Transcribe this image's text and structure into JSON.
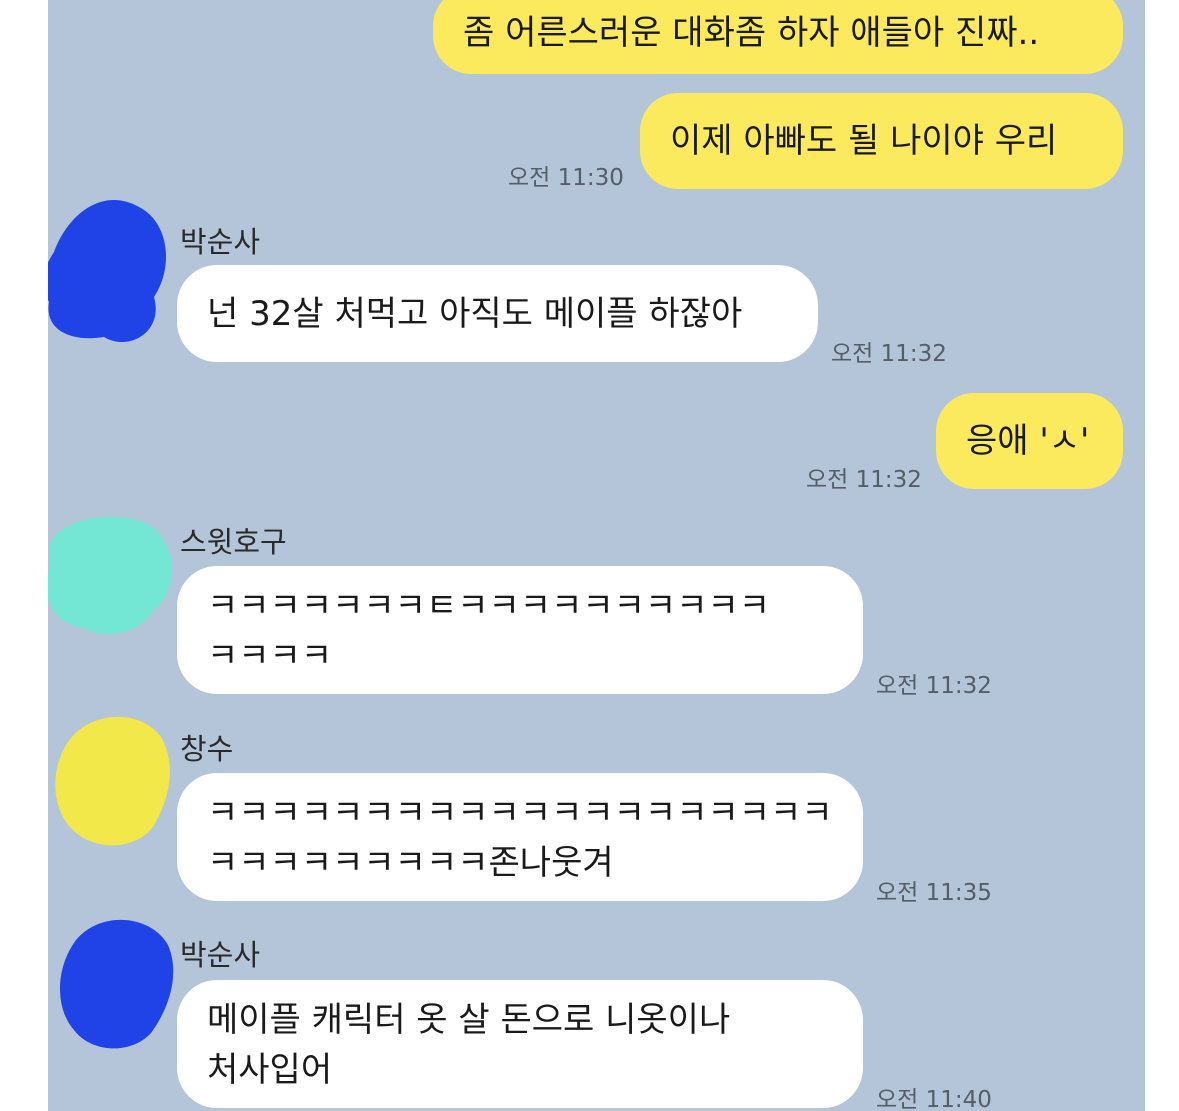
{
  "messages": [
    {
      "side": "mine",
      "text": "좀 어른스러운 대화좀 하자 애들아 진짜.."
    },
    {
      "side": "mine",
      "text": "이제 아빠도 될 나이야 우리",
      "time": "오전 11:30"
    },
    {
      "side": "theirs",
      "sender": "박순사",
      "text": "넌 32살 처먹고 아직도 메이플 하잖아",
      "time": "오전 11:32"
    },
    {
      "side": "mine",
      "text": "응애 'ㅅ'",
      "time": "오전 11:32"
    },
    {
      "side": "theirs",
      "sender": "스윗호구",
      "text": "ㅋㅋㅋㅋㅋㅋㅋㅌㅋㅋㅋㅋㅋㅋㅋㅋㅋㅋ\nㅋㅋㅋㅋ",
      "time": "오전 11:32"
    },
    {
      "side": "theirs",
      "sender": "창수",
      "text": "ㅋㅋㅋㅋㅋㅋㅋㅋㅋㅋㅋㅋㅋㅋㅋㅋㅋㅋㅋㅋ\nㅋㅋㅋㅋㅋㅋㅋㅋㅋ존나웃겨",
      "time": "오전 11:35"
    },
    {
      "side": "theirs",
      "sender": "박순사",
      "text": "메이플 캐릭터 옷 살 돈으로 니옷이나\n처사입어",
      "time": "오전 11:40"
    }
  ],
  "avatars": [
    {
      "name": "avatar-blue",
      "color": "#1f43e6"
    },
    {
      "name": "avatar-teal",
      "color": "#74e6d4"
    },
    {
      "name": "avatar-yellow",
      "color": "#f2e84a"
    },
    {
      "name": "avatar-blue-2",
      "color": "#1f43e6"
    }
  ]
}
